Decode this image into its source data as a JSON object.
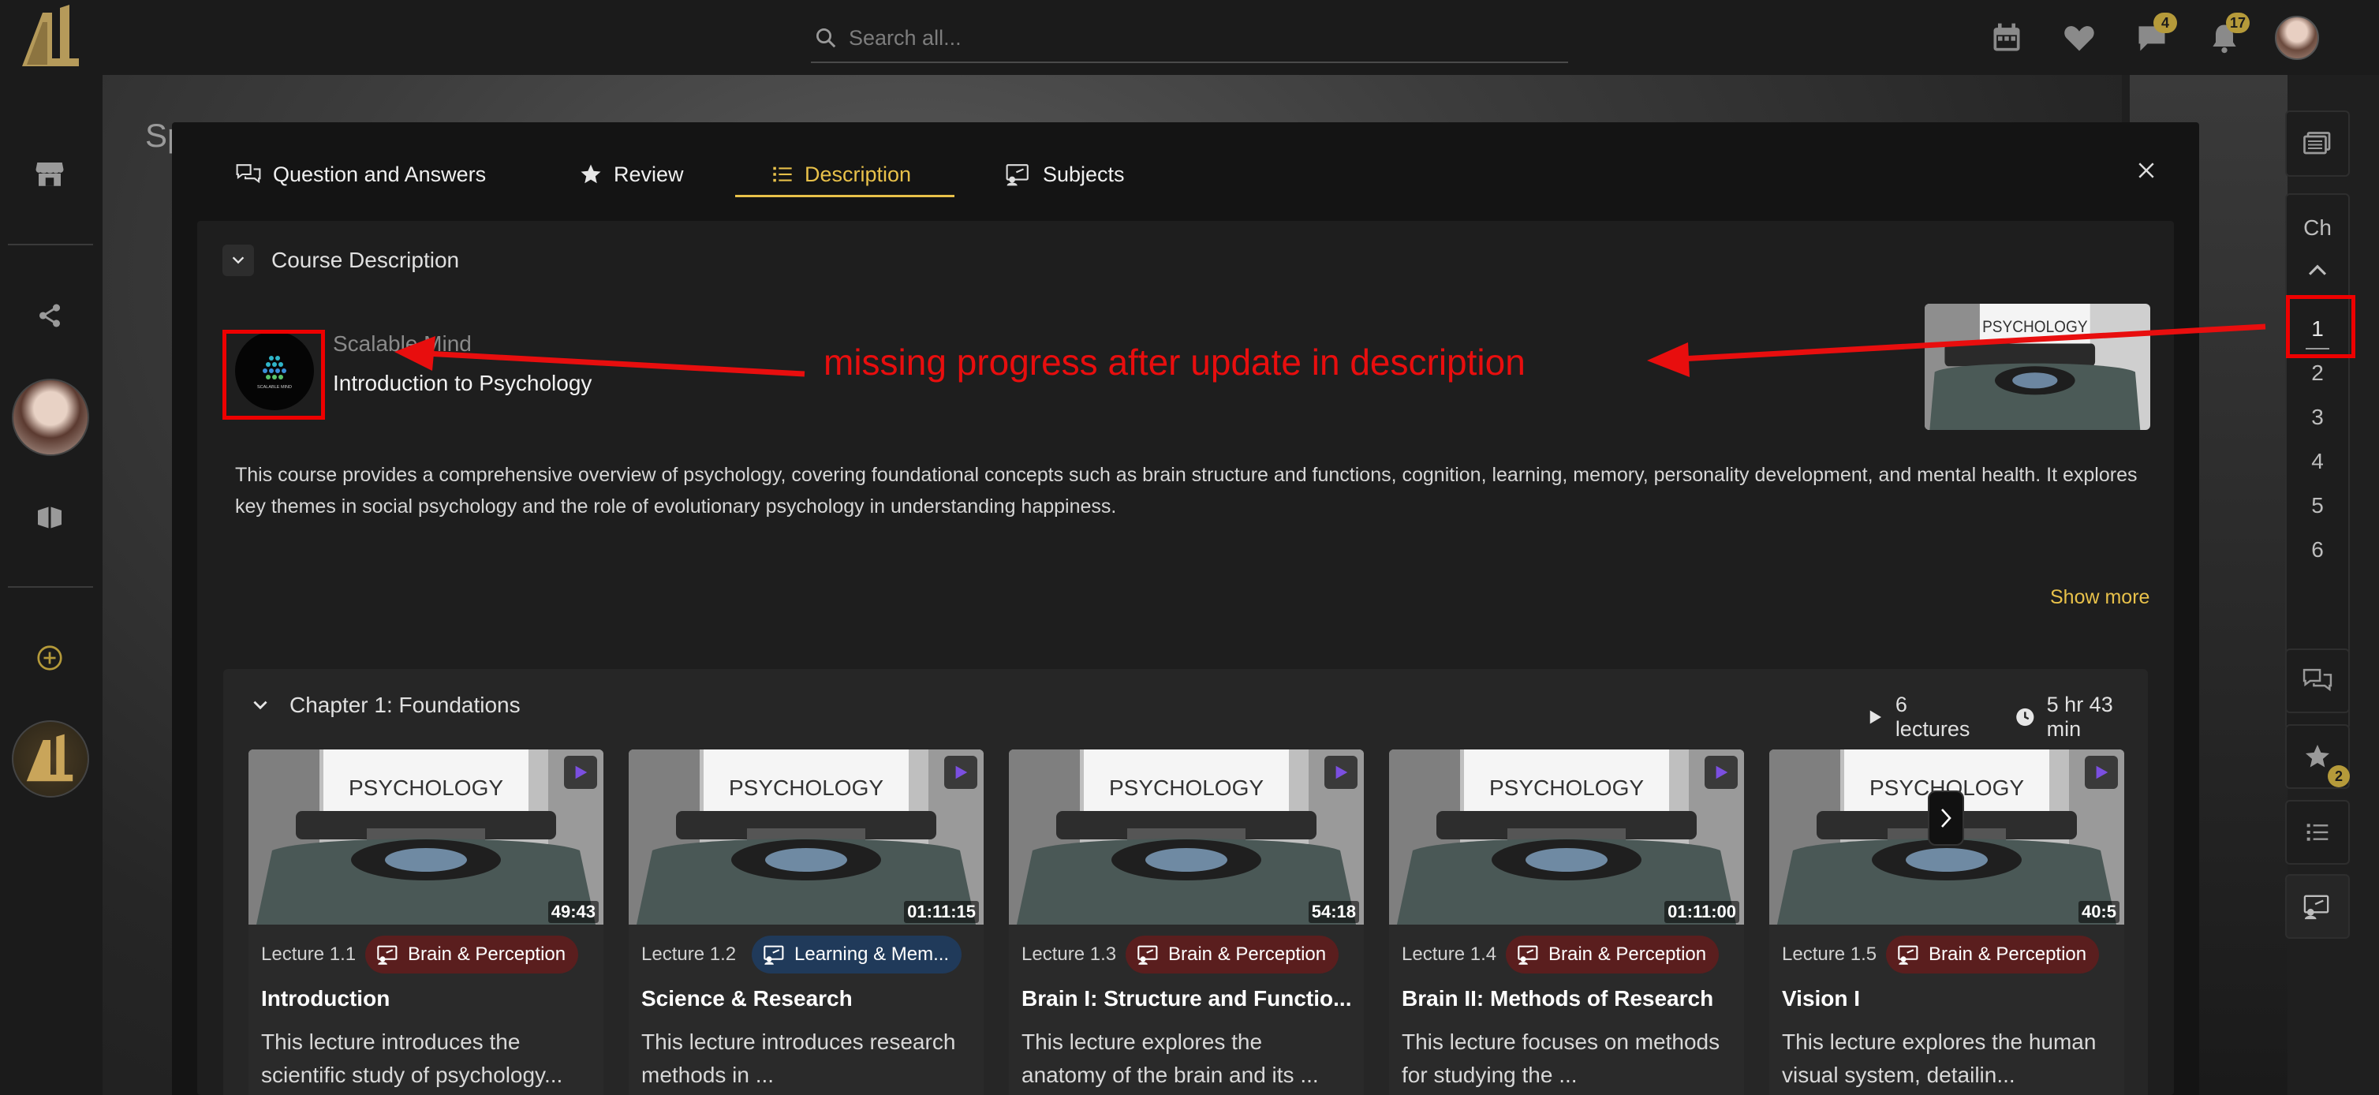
{
  "search": {
    "placeholder": "Search all..."
  },
  "topbar": {
    "messages_badge": "4",
    "notifications_badge": "17"
  },
  "background": {
    "title_fragment": "Sp"
  },
  "tabs": [
    {
      "label": "Question and Answers",
      "icon": "chat-icon"
    },
    {
      "label": "Review",
      "icon": "star-icon"
    },
    {
      "label": "Description",
      "icon": "list-icon",
      "active": true
    },
    {
      "label": "Subjects",
      "icon": "subjects-icon"
    }
  ],
  "description_section": {
    "header": "Course Description",
    "publisher": "Scalable Mind",
    "logo_text": "SCALABLE MIND",
    "course_title": "Introduction to Psychology",
    "text": "This course provides a comprehensive overview of psychology, covering foundational concepts such as brain structure and functions, cognition, learning, memory, personality development, and mental health. It explores key themes in social psychology and the role of evolutionary psychology in understanding happiness.",
    "show_more": "Show more"
  },
  "annotation": {
    "text": "missing progress after update in description"
  },
  "chapter": {
    "title": "Chapter 1: Foundations",
    "lectures": "6 lectures",
    "duration": "5 hr 43 min"
  },
  "thumb_text": "PSYCHOLOGY",
  "lectures": [
    {
      "number": "Lecture 1.1",
      "tag": "Brain & Perception",
      "tag_color": "#5a1e1e",
      "duration": "49:43",
      "title": "Introduction",
      "desc": "This lecture introduces the scientific study of psychology..."
    },
    {
      "number": "Lecture 1.2",
      "tag": "Learning & Mem...",
      "tag_color": "#203a5a",
      "duration": "01:11:15",
      "title": "Science & Research",
      "desc": "This lecture introduces research methods in ..."
    },
    {
      "number": "Lecture 1.3",
      "tag": "Brain & Perception",
      "tag_color": "#5a1e1e",
      "duration": "54:18",
      "title": "Brain I: Structure and Functio...",
      "desc": "This lecture explores the anatomy of the brain and its ..."
    },
    {
      "number": "Lecture 1.4",
      "tag": "Brain & Perception",
      "tag_color": "#5a1e1e",
      "duration": "01:11:00",
      "title": "Brain II: Methods of Research",
      "desc": "This lecture focuses on methods for studying the ..."
    },
    {
      "number": "Lecture 1.5",
      "tag": "Brain & Perception",
      "tag_color": "#5a1e1e",
      "duration": "40:5",
      "title": "Vision I",
      "desc": "This lecture explores the human visual system, detailin..."
    }
  ],
  "right_sidebar": {
    "chapters_label": "Ch",
    "chapter_numbers": [
      "1",
      "2",
      "3",
      "4",
      "5",
      "6"
    ],
    "reviews_badge": "2"
  },
  "colors": {
    "accent": "#e8c14a",
    "annotation": "#e80e0e",
    "play": "#7b4fe0"
  }
}
